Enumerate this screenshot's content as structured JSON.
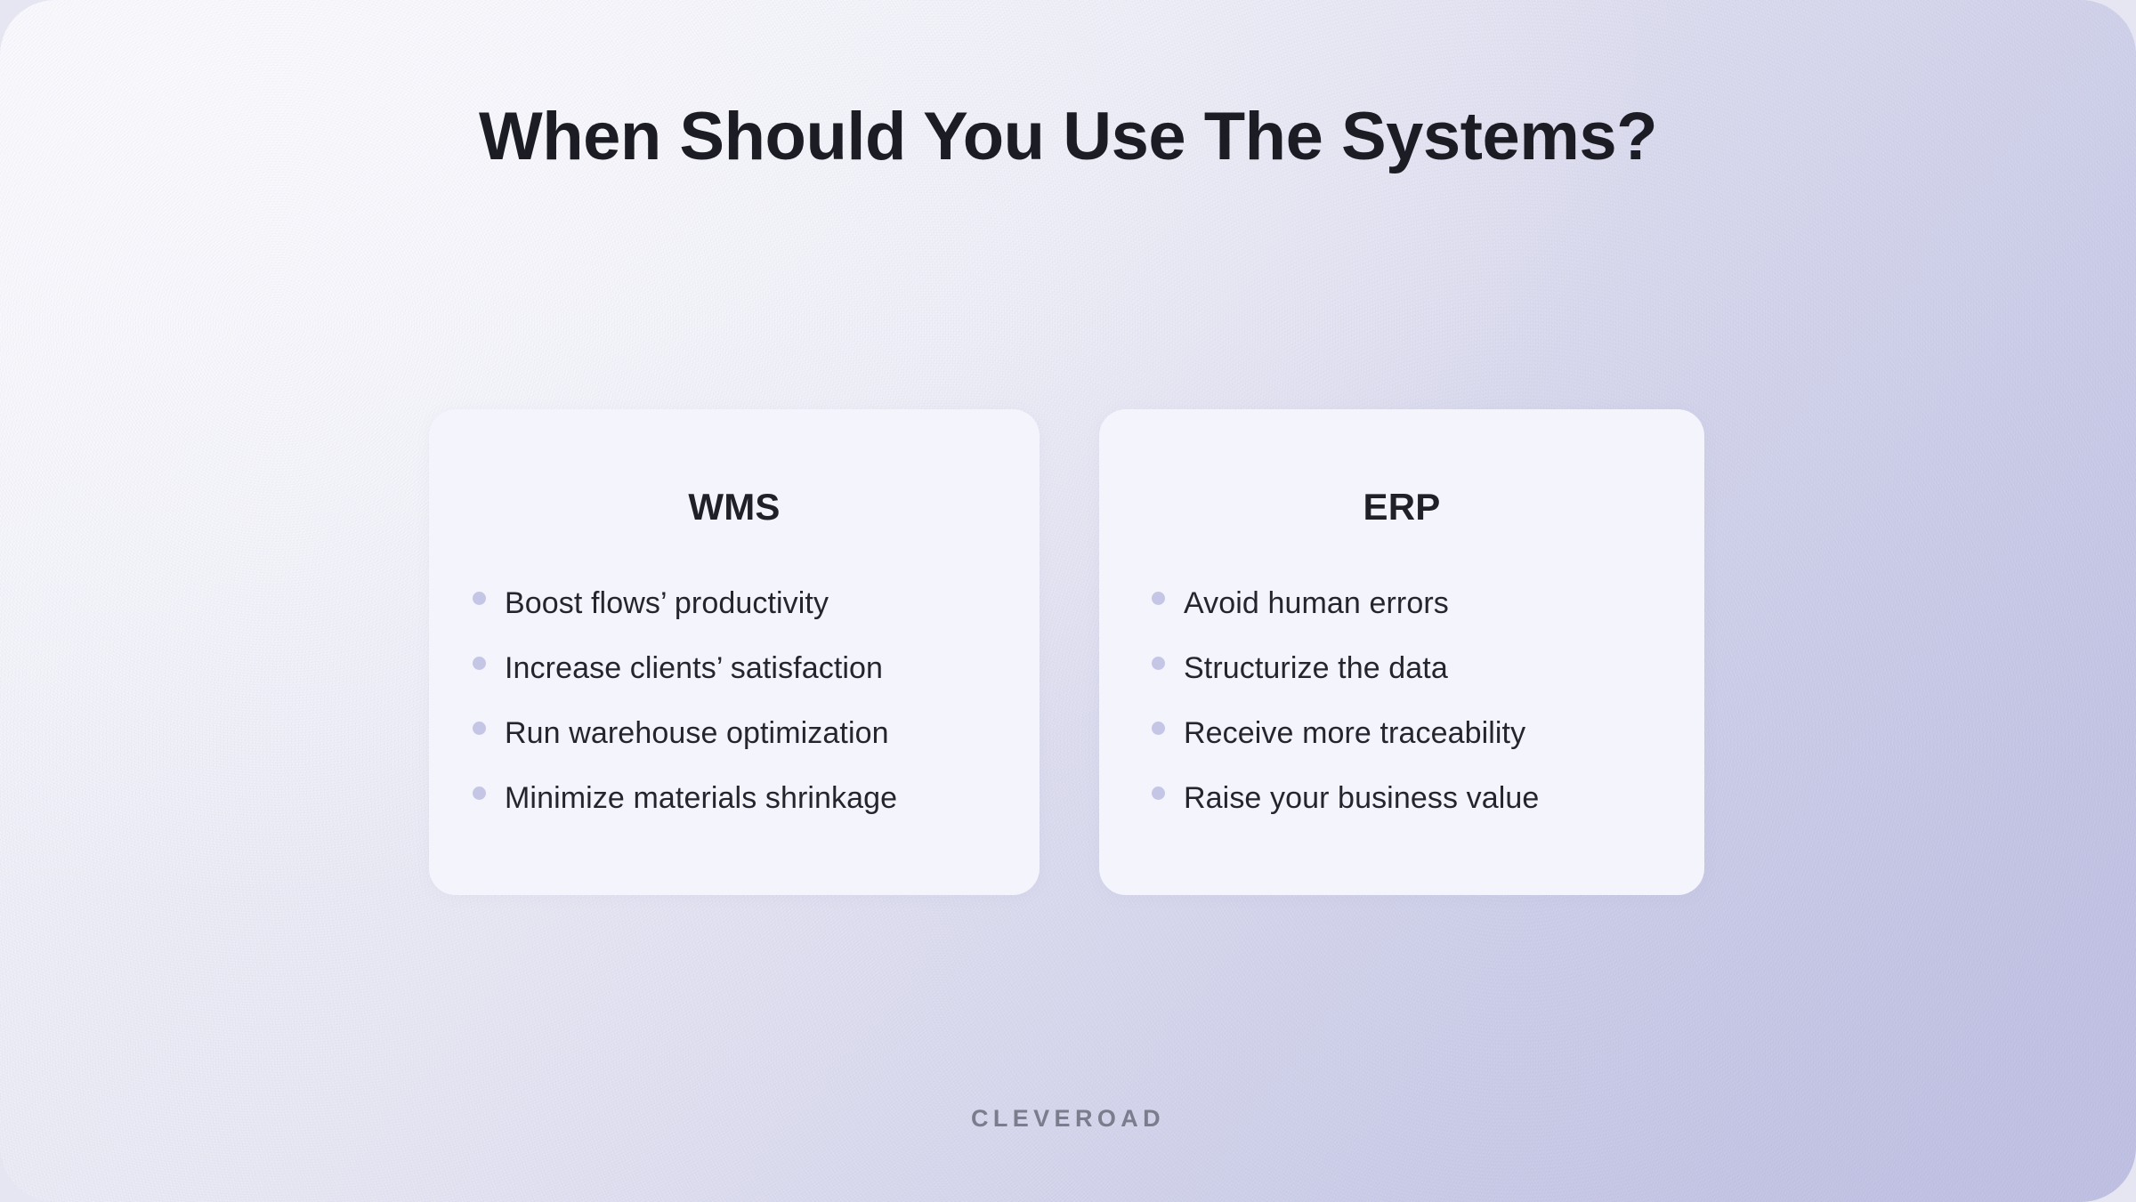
{
  "slide": {
    "title": "When Should You Use The Systems?",
    "footer_logo": "CLEVEROAD",
    "colors": {
      "title_text": "#1c1d24",
      "card_background": "#f4f4fc",
      "bullet_dot": "#c5c6e6",
      "body_text": "#24252d",
      "footer_text": "#7b7d8c",
      "gradient_start": "#f6f6fc",
      "gradient_end": "#c1c2e4"
    }
  },
  "cards": [
    {
      "heading": "WMS",
      "bullets": [
        "Boost flows’ productivity",
        "Increase clients’ satisfaction",
        "Run warehouse optimization",
        "Minimize materials shrinkage"
      ]
    },
    {
      "heading": "ERP",
      "bullets": [
        "Avoid human errors",
        "Structurize the data",
        "Receive more traceability",
        "Raise your business value"
      ]
    }
  ]
}
